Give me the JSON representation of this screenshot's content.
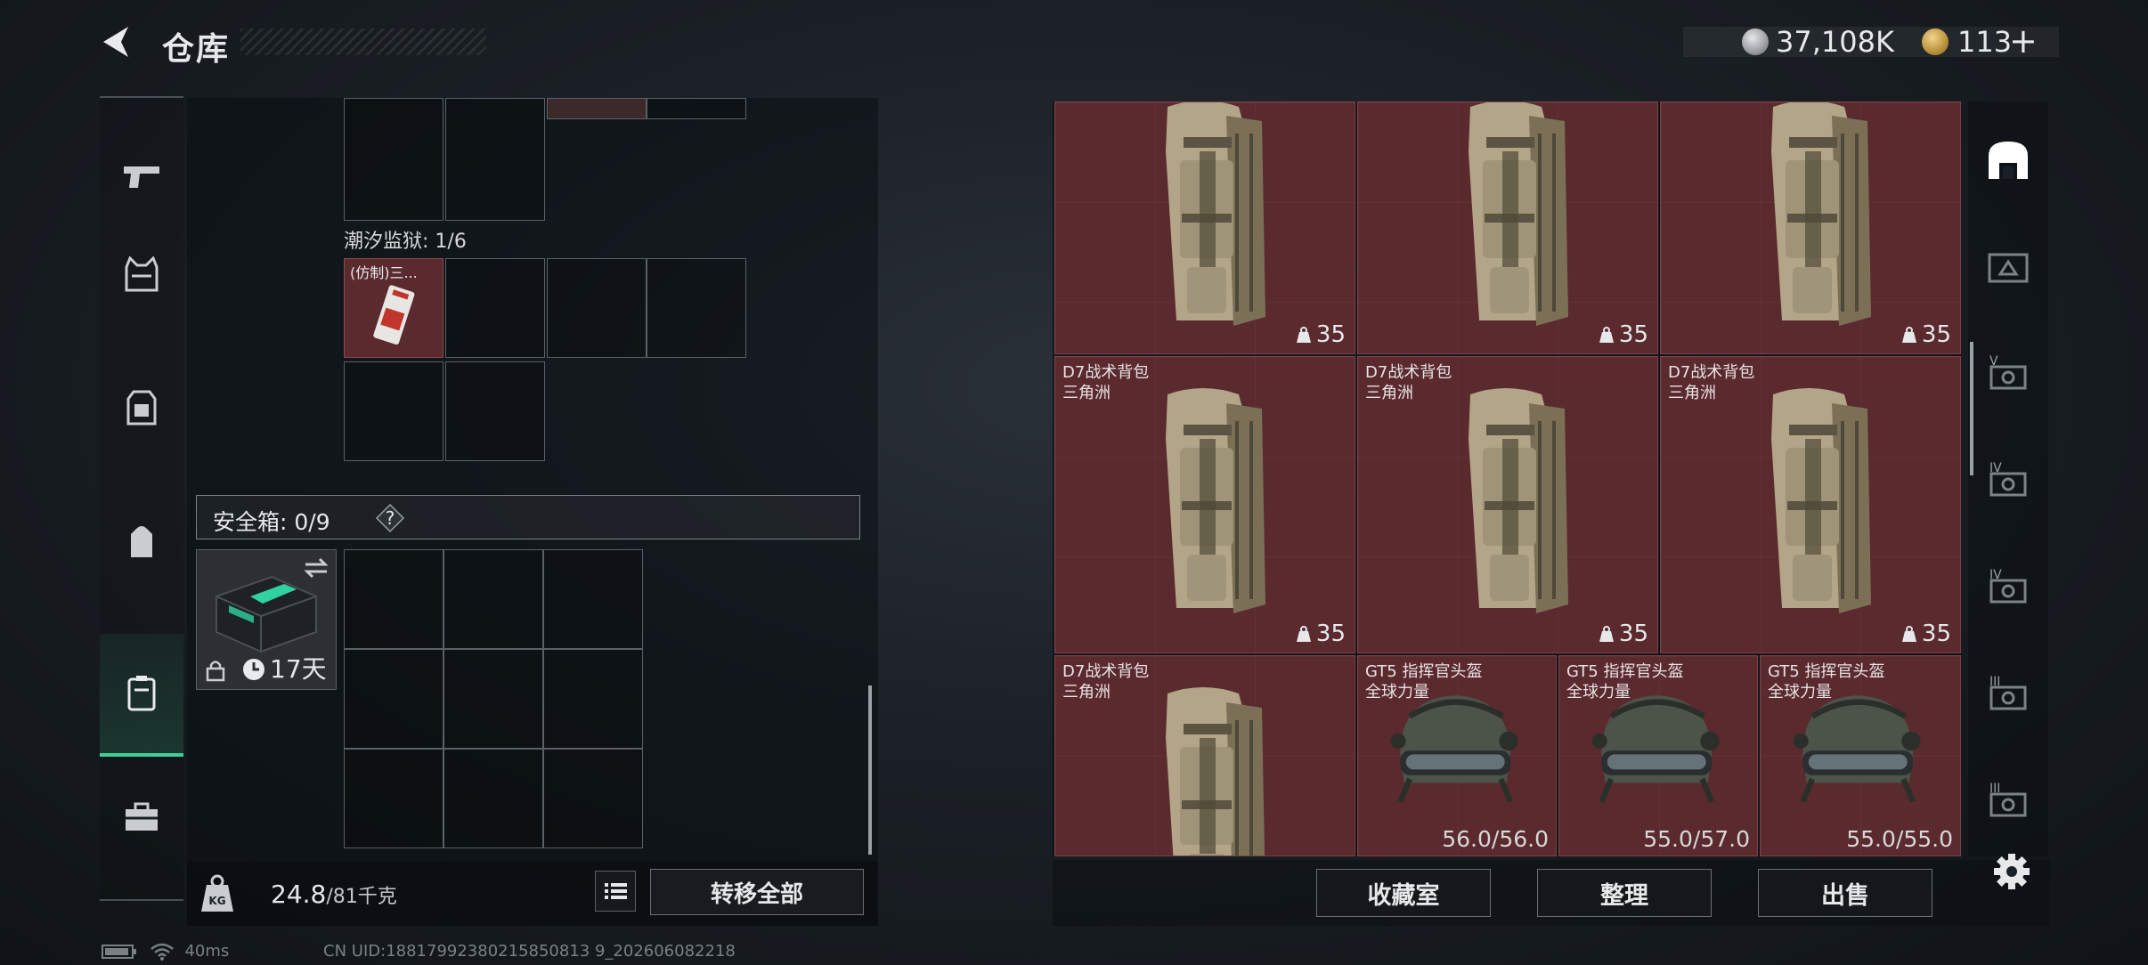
{
  "header": {
    "title": "仓库",
    "currency_main": "37,108K",
    "currency_secondary": "113",
    "add_label": "+"
  },
  "sidebar_left": {
    "items": [
      {
        "name": "weapons",
        "icon": "pistol-icon"
      },
      {
        "name": "armor",
        "icon": "vest-icon"
      },
      {
        "name": "rig",
        "icon": "chest-rig-icon"
      },
      {
        "name": "backpack",
        "icon": "backpack-icon"
      },
      {
        "name": "safebox",
        "icon": "safebox-icon",
        "active": true
      },
      {
        "name": "toolbox",
        "icon": "toolbox-icon"
      }
    ]
  },
  "left_panel": {
    "prison_label": "潮汐监狱: 1/6",
    "prison_item_label": "(仿制)三...",
    "safebox_label": "安全箱: 0/9",
    "help_symbol": "?",
    "safebox_days": "17天",
    "weight_current": "24.8",
    "weight_max": "/81千克",
    "transfer_all": "转移全部"
  },
  "items": [
    {
      "name": "",
      "sub": "",
      "count": "35"
    },
    {
      "name": "",
      "sub": "",
      "count": "35"
    },
    {
      "name": "",
      "sub": "",
      "count": "35"
    },
    {
      "name": "D7战术背包",
      "sub": "三角洲",
      "count": "35"
    },
    {
      "name": "D7战术背包",
      "sub": "三角洲",
      "count": "35"
    },
    {
      "name": "D7战术背包",
      "sub": "三角洲",
      "count": "35"
    },
    {
      "name": "D7战术背包",
      "sub": "三角洲",
      "count": ""
    },
    {
      "name": "GT5 指挥官头盔",
      "sub": "全球力量",
      "durability": "56.0/56.0"
    },
    {
      "name": "GT5 指挥官头盔",
      "sub": "全球力量",
      "durability": "55.0/57.0"
    },
    {
      "name": "GT5 指挥官头盔",
      "sub": "全球力量",
      "durability": "55.0/55.0"
    }
  ],
  "sidebar_right": {
    "tiers": [
      "",
      "",
      "V",
      "IV",
      "IV",
      "III",
      "III"
    ]
  },
  "actions": {
    "collection": "收藏室",
    "sort": "整理",
    "sell": "出售"
  },
  "status": {
    "ping": "40ms",
    "uid": "CN UID:18817992380215850813 9_202606082218"
  },
  "colors": {
    "item_bg": "#5a2a2f",
    "accent": "#3fcf95"
  }
}
